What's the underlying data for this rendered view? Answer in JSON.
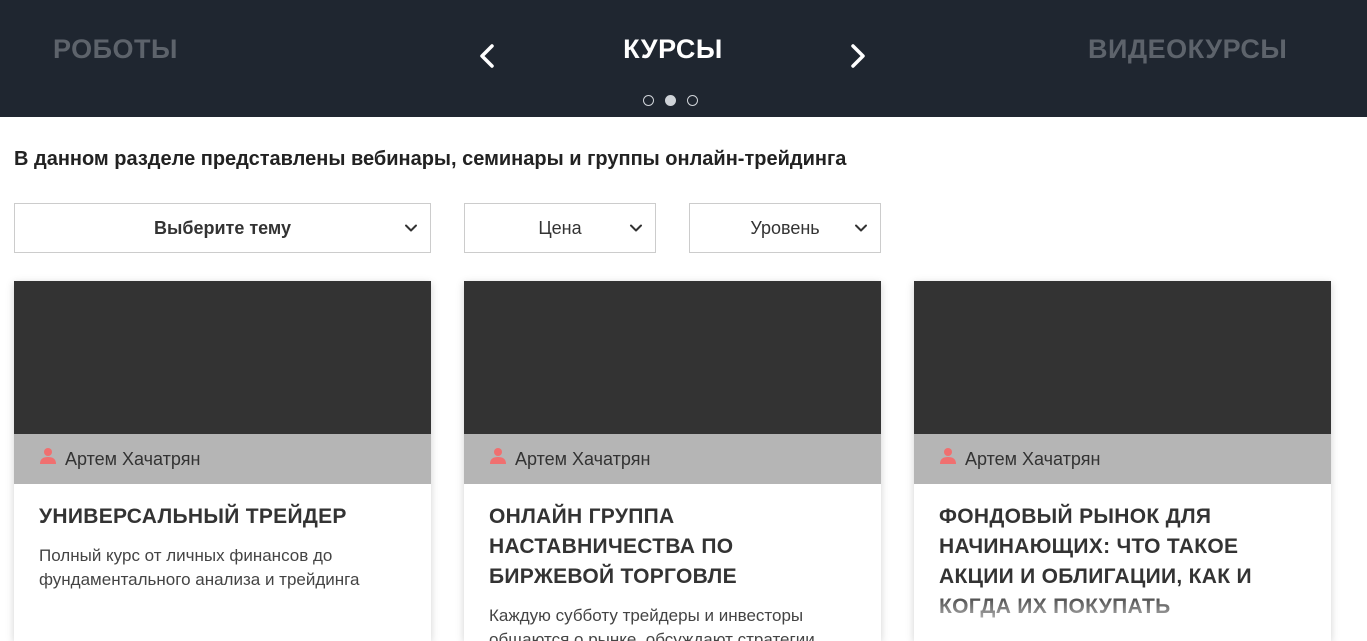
{
  "carousel": {
    "prev_title": "РОБОТЫ",
    "current_title": "КУРСЫ",
    "next_title": "ВИДЕОКУРСЫ",
    "slides_total": 3,
    "active_slide": 2
  },
  "intro": {
    "text": "В данном разделе представлены вебинары, семинары и группы онлайн-трейдинга"
  },
  "filters": {
    "topic": "Выберите тему",
    "price": "Цена",
    "level": "Уровень"
  },
  "cards": [
    {
      "author": "Артем Хачатрян",
      "title": "УНИВЕРСАЛЬНЫЙ ТРЕЙДЕР",
      "description": "Полный курс от личных финансов до фундаментального анализа и трейдинга"
    },
    {
      "author": "Артем Хачатрян",
      "title": "ОНЛАЙН ГРУППА НАСТАВНИЧЕСТВА ПО БИРЖЕВОЙ ТОРГОВЛЕ",
      "description": "Каждую субботу трейдеры и инвесторы общаются о рынке, обсуждают стратегии."
    },
    {
      "author": "Артем Хачатрян",
      "title": "ФОНДОВЫЙ РЫНОК ДЛЯ НАЧИНАЮЩИХ: ЧТО ТАКОЕ АКЦИИ И ОБЛИГАЦИИ, КАК И КОГДА ИХ ПОКУПАТЬ",
      "description": ""
    }
  ],
  "colors": {
    "header_bg": "#1f2630",
    "inactive_title": "#5d636b",
    "thumb_bg": "#333333",
    "author_bar_bg": "#b5b5b5",
    "author_icon": "#f07070"
  },
  "icons": {
    "prev": "chevron-left-icon",
    "next": "chevron-right-icon",
    "dropdown": "chevron-down-icon",
    "author": "user-icon"
  }
}
